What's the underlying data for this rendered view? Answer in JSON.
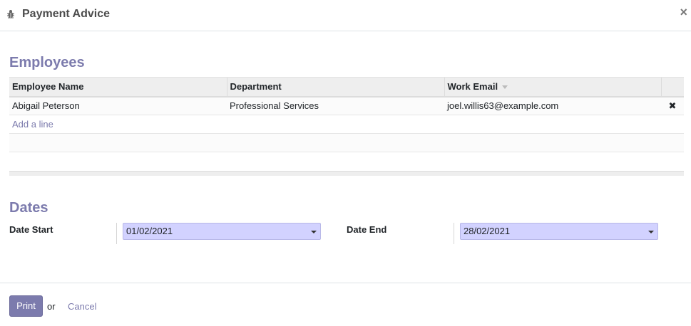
{
  "dialog": {
    "title": "Payment Advice",
    "close_symbol": "×"
  },
  "employees": {
    "section_title": "Employees",
    "columns": [
      "Employee Name",
      "Department",
      "Work Email"
    ],
    "rows": [
      {
        "name": "Abigail Peterson",
        "department": "Professional Services",
        "email": "joel.willis63@example.com"
      }
    ],
    "add_line_label": "Add a line",
    "delete_symbol": "✖"
  },
  "dates": {
    "section_title": "Dates",
    "start_label": "Date Start",
    "start_value": "01/02/2021",
    "end_label": "Date End",
    "end_value": "28/02/2021"
  },
  "footer": {
    "print_label": "Print",
    "or_text": "or",
    "cancel_label": "Cancel"
  },
  "colors": {
    "accent": "#7c7bad",
    "input_required_bg": "#d2d2ff"
  }
}
